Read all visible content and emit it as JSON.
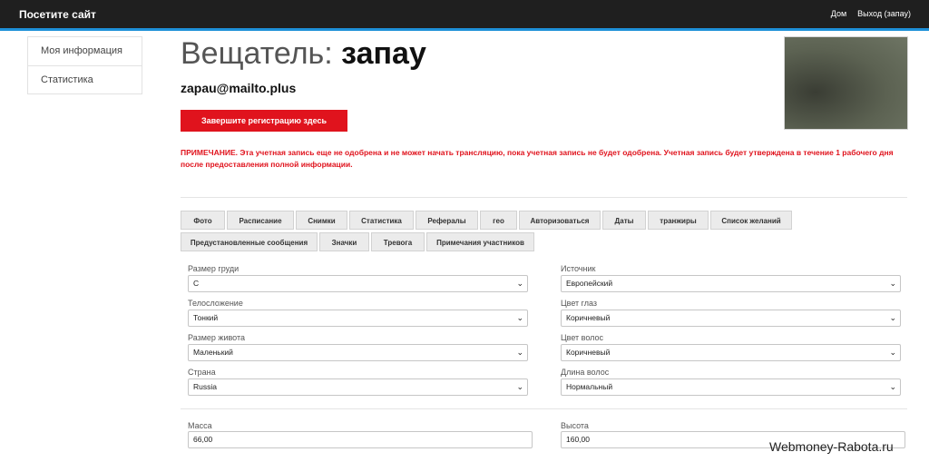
{
  "header": {
    "brand": "Посетите сайт",
    "nav": [
      "Дом",
      "Выход (запау)"
    ]
  },
  "sidebar": {
    "items": [
      {
        "label": "Моя информация"
      },
      {
        "label": "Статистика"
      }
    ]
  },
  "profile": {
    "title_label": "Вещатель:",
    "title_name": "запау",
    "email": "zapau@mailto.plus",
    "register_button": "Завершите регистрацию здесь",
    "notice": "ПРИМЕЧАНИЕ. Эта учетная запись еще не одобрена и не может начать трансляцию, пока учетная запись не будет одобрена. Учетная запись будет утверждена в течение 1 рабочего дня после предоставления полной информации."
  },
  "tabs": [
    "Фото",
    "Расписание",
    "Снимки",
    "Статистика",
    "Рефералы",
    "гео",
    "Авторизоваться",
    "Даты",
    "транжиры",
    "Список желаний",
    "Предустановленные сообщения",
    "Значки",
    "Тревога",
    "Примечания участников"
  ],
  "form": {
    "left": [
      {
        "label": "Размер груди",
        "value": "C"
      },
      {
        "label": "Телосложение",
        "value": "Тонкий"
      },
      {
        "label": "Размер живота",
        "value": "Маленький"
      },
      {
        "label": "Страна",
        "value": "Russia"
      }
    ],
    "right": [
      {
        "label": "Источник",
        "value": "Европейский"
      },
      {
        "label": "Цвет глаз",
        "value": "Коричневый"
      },
      {
        "label": "Цвет волос",
        "value": "Коричневый"
      },
      {
        "label": "Длина волос",
        "value": "Нормальный"
      }
    ],
    "mass": {
      "label": "Масса",
      "value": "66,00"
    },
    "height": {
      "label": "Высота",
      "value": "160,00"
    }
  },
  "watermark": "Webmoney-Rabota.ru"
}
